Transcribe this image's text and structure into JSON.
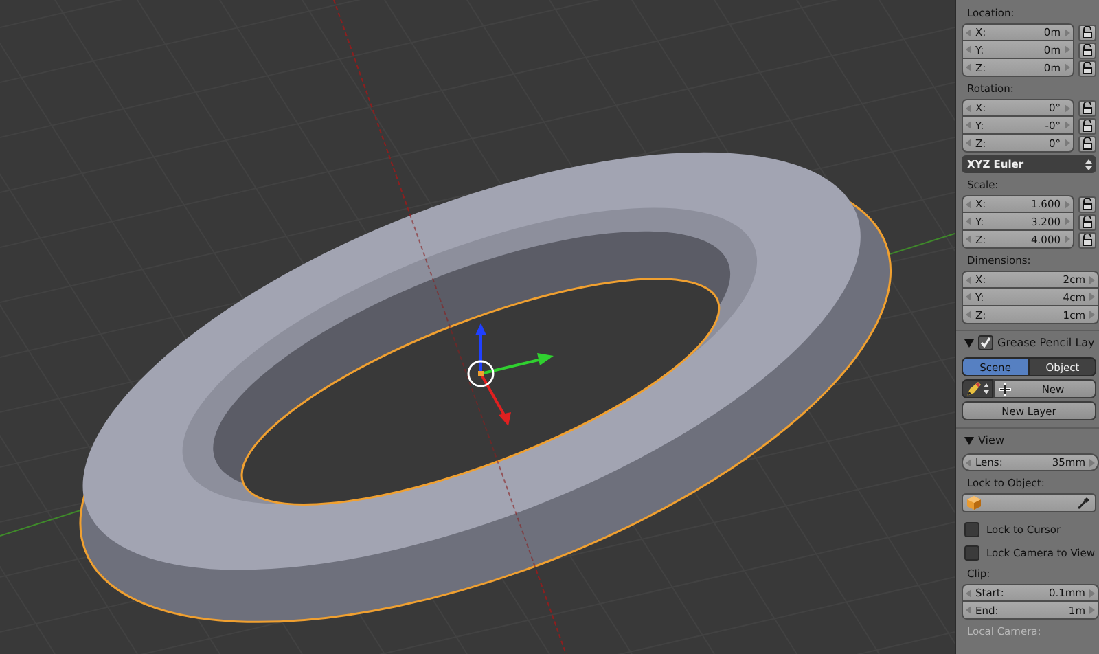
{
  "panel": {
    "items": [
      {
        "kind": "label",
        "text": "Location:"
      },
      {
        "kind": "vector",
        "locks": true,
        "fields": [
          {
            "label": "X:",
            "value": "0m"
          },
          {
            "label": "Y:",
            "value": "0m"
          },
          {
            "label": "Z:",
            "value": "0m"
          }
        ]
      },
      {
        "kind": "label",
        "text": "Rotation:"
      },
      {
        "kind": "vector",
        "locks": true,
        "fields": [
          {
            "label": "X:",
            "value": "0°"
          },
          {
            "label": "Y:",
            "value": "-0°"
          },
          {
            "label": "Z:",
            "value": "0°"
          }
        ]
      },
      {
        "kind": "dropdown",
        "value": "XYZ Euler"
      },
      {
        "kind": "label",
        "text": "Scale:"
      },
      {
        "kind": "vector",
        "locks": true,
        "fields": [
          {
            "label": "X:",
            "value": "1.600"
          },
          {
            "label": "Y:",
            "value": "3.200"
          },
          {
            "label": "Z:",
            "value": "4.000"
          }
        ]
      },
      {
        "kind": "label",
        "text": "Dimensions:"
      },
      {
        "kind": "vector",
        "locks": false,
        "fields": [
          {
            "label": "X:",
            "value": "2cm"
          },
          {
            "label": "Y:",
            "value": "4cm"
          },
          {
            "label": "Z:",
            "value": "1cm"
          }
        ]
      },
      {
        "kind": "section",
        "title": "Grease Pencil Lay",
        "expanded": true,
        "checked": true
      },
      {
        "kind": "tabs",
        "tabs": [
          {
            "label": "Scene",
            "selected": true
          },
          {
            "label": "Object",
            "selected": false
          }
        ]
      },
      {
        "kind": "new_row",
        "label": "New"
      },
      {
        "kind": "button",
        "label": "New Layer"
      },
      {
        "kind": "section",
        "title": "View",
        "expanded": true
      },
      {
        "kind": "vector",
        "locks": false,
        "fields": [
          {
            "label": "Lens:",
            "value": "35mm"
          }
        ]
      },
      {
        "kind": "label",
        "text": "Lock to Object:"
      },
      {
        "kind": "object_field"
      },
      {
        "kind": "checkbox",
        "label": "Lock to Cursor",
        "checked": false
      },
      {
        "kind": "checkbox",
        "label": "Lock Camera to View",
        "checked": false
      },
      {
        "kind": "label",
        "text": "Clip:"
      },
      {
        "kind": "vector",
        "locks": false,
        "fields": [
          {
            "label": "Start:",
            "value": "0.1mm"
          },
          {
            "label": "End:",
            "value": "1m"
          }
        ]
      },
      {
        "kind": "label",
        "text": "Local Camera:",
        "disabled": true
      }
    ]
  }
}
